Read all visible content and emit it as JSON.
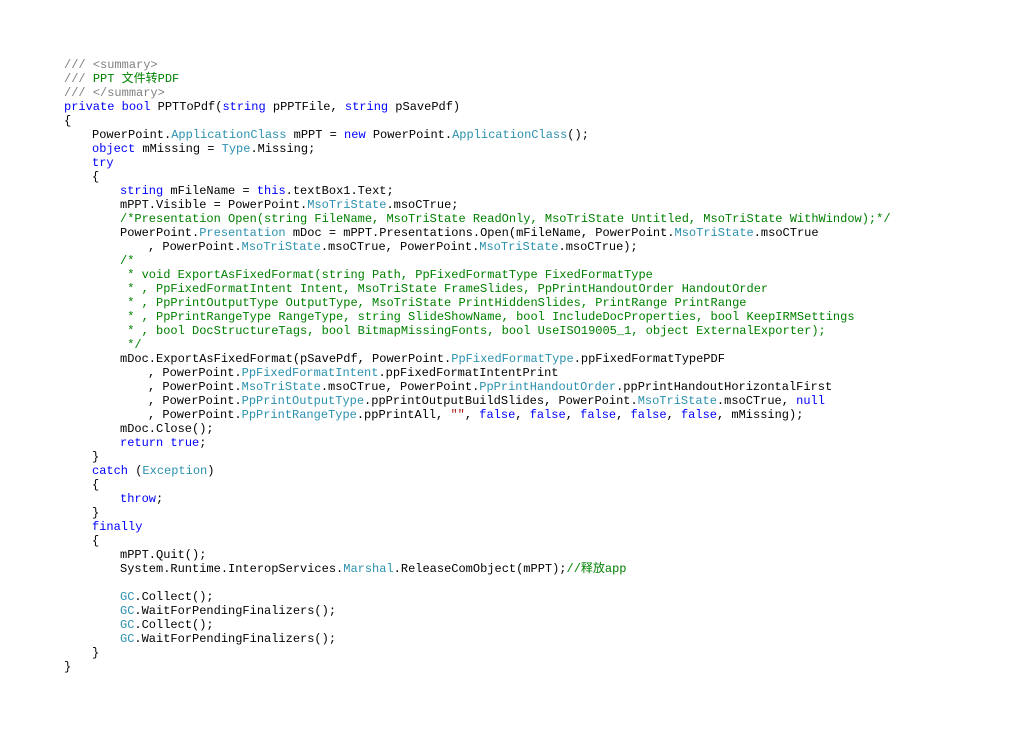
{
  "code": {
    "lines": [
      {
        "indent": 56,
        "tokens": [
          {
            "t": "/// ",
            "c": "c-comment"
          },
          {
            "t": "<summary>",
            "c": "c-comment"
          }
        ]
      },
      {
        "indent": 56,
        "tokens": [
          {
            "t": "/// ",
            "c": "c-comment"
          },
          {
            "t": "PPT 文件转PDF",
            "c": "c-doc"
          }
        ]
      },
      {
        "indent": 56,
        "tokens": [
          {
            "t": "/// ",
            "c": "c-comment"
          },
          {
            "t": "</summary>",
            "c": "c-comment"
          }
        ]
      },
      {
        "indent": 56,
        "tokens": [
          {
            "t": "private",
            "c": "c-kw"
          },
          {
            "t": " ",
            "c": "c-txt"
          },
          {
            "t": "bool",
            "c": "c-kw"
          },
          {
            "t": " PPTToPdf(",
            "c": "c-txt"
          },
          {
            "t": "string",
            "c": "c-kw"
          },
          {
            "t": " pPPTFile, ",
            "c": "c-txt"
          },
          {
            "t": "string",
            "c": "c-kw"
          },
          {
            "t": " pSavePdf)",
            "c": "c-txt"
          }
        ]
      },
      {
        "indent": 56,
        "tokens": [
          {
            "t": "{",
            "c": "c-txt"
          }
        ]
      },
      {
        "indent": 84,
        "tokens": [
          {
            "t": "PowerPoint.",
            "c": "c-txt"
          },
          {
            "t": "ApplicationClass",
            "c": "c-type"
          },
          {
            "t": " mPPT = ",
            "c": "c-txt"
          },
          {
            "t": "new",
            "c": "c-kw"
          },
          {
            "t": " PowerPoint.",
            "c": "c-txt"
          },
          {
            "t": "ApplicationClass",
            "c": "c-type"
          },
          {
            "t": "();",
            "c": "c-txt"
          }
        ]
      },
      {
        "indent": 84,
        "tokens": [
          {
            "t": "object",
            "c": "c-kw"
          },
          {
            "t": " mMissing = ",
            "c": "c-txt"
          },
          {
            "t": "Type",
            "c": "c-type"
          },
          {
            "t": ".Missing;",
            "c": "c-txt"
          }
        ]
      },
      {
        "indent": 84,
        "tokens": [
          {
            "t": "try",
            "c": "c-kw"
          }
        ]
      },
      {
        "indent": 84,
        "tokens": [
          {
            "t": "{",
            "c": "c-txt"
          }
        ]
      },
      {
        "indent": 112,
        "tokens": [
          {
            "t": "string",
            "c": "c-kw"
          },
          {
            "t": " mFileName = ",
            "c": "c-txt"
          },
          {
            "t": "this",
            "c": "c-kw"
          },
          {
            "t": ".textBox1.Text;",
            "c": "c-txt"
          }
        ]
      },
      {
        "indent": 112,
        "tokens": [
          {
            "t": "mPPT.Visible = PowerPoint.",
            "c": "c-txt"
          },
          {
            "t": "MsoTriState",
            "c": "c-type"
          },
          {
            "t": ".msoCTrue;",
            "c": "c-txt"
          }
        ]
      },
      {
        "indent": 112,
        "tokens": [
          {
            "t": "/*Presentation Open(string FileName, MsoTriState ReadOnly, MsoTriState Untitled, MsoTriState WithWindow);*/",
            "c": "c-doc"
          }
        ]
      },
      {
        "indent": 112,
        "tokens": [
          {
            "t": "PowerPoint.",
            "c": "c-txt"
          },
          {
            "t": "Presentation",
            "c": "c-type"
          },
          {
            "t": " mDoc = mPPT.Presentations.Open(mFileName, PowerPoint.",
            "c": "c-txt"
          },
          {
            "t": "MsoTriState",
            "c": "c-type"
          },
          {
            "t": ".msoCTrue",
            "c": "c-txt"
          }
        ]
      },
      {
        "indent": 140,
        "tokens": [
          {
            "t": ", PowerPoint.",
            "c": "c-txt"
          },
          {
            "t": "MsoTriState",
            "c": "c-type"
          },
          {
            "t": ".msoCTrue, PowerPoint.",
            "c": "c-txt"
          },
          {
            "t": "MsoTriState",
            "c": "c-type"
          },
          {
            "t": ".msoCTrue);",
            "c": "c-txt"
          }
        ]
      },
      {
        "indent": 112,
        "tokens": [
          {
            "t": "/*",
            "c": "c-doc"
          }
        ]
      },
      {
        "indent": 112,
        "tokens": [
          {
            "t": " * void ExportAsFixedFormat(string Path, PpFixedFormatType FixedFormatType",
            "c": "c-doc"
          }
        ]
      },
      {
        "indent": 112,
        "tokens": [
          {
            "t": " * , PpFixedFormatIntent Intent, MsoTriState FrameSlides, PpPrintHandoutOrder HandoutOrder",
            "c": "c-doc"
          }
        ]
      },
      {
        "indent": 112,
        "tokens": [
          {
            "t": " * , PpPrintOutputType OutputType, MsoTriState PrintHiddenSlides, PrintRange PrintRange",
            "c": "c-doc"
          }
        ]
      },
      {
        "indent": 112,
        "tokens": [
          {
            "t": " * , PpPrintRangeType RangeType, string SlideShowName, bool IncludeDocProperties, bool KeepIRMSettings",
            "c": "c-doc"
          }
        ]
      },
      {
        "indent": 112,
        "tokens": [
          {
            "t": " * , bool DocStructureTags, bool BitmapMissingFonts, bool UseISO19005_1, object ExternalExporter);",
            "c": "c-doc"
          }
        ]
      },
      {
        "indent": 112,
        "tokens": [
          {
            "t": " */",
            "c": "c-doc"
          }
        ]
      },
      {
        "indent": 112,
        "tokens": [
          {
            "t": "mDoc.ExportAsFixedFormat(pSavePdf, PowerPoint.",
            "c": "c-txt"
          },
          {
            "t": "PpFixedFormatType",
            "c": "c-type"
          },
          {
            "t": ".ppFixedFormatTypePDF",
            "c": "c-txt"
          }
        ]
      },
      {
        "indent": 140,
        "tokens": [
          {
            "t": ", PowerPoint.",
            "c": "c-txt"
          },
          {
            "t": "PpFixedFormatIntent",
            "c": "c-type"
          },
          {
            "t": ".ppFixedFormatIntentPrint",
            "c": "c-txt"
          }
        ]
      },
      {
        "indent": 140,
        "tokens": [
          {
            "t": ", PowerPoint.",
            "c": "c-txt"
          },
          {
            "t": "MsoTriState",
            "c": "c-type"
          },
          {
            "t": ".msoCTrue, PowerPoint.",
            "c": "c-txt"
          },
          {
            "t": "PpPrintHandoutOrder",
            "c": "c-type"
          },
          {
            "t": ".ppPrintHandoutHorizontalFirst",
            "c": "c-txt"
          }
        ]
      },
      {
        "indent": 140,
        "tokens": [
          {
            "t": ", PowerPoint.",
            "c": "c-txt"
          },
          {
            "t": "PpPrintOutputType",
            "c": "c-type"
          },
          {
            "t": ".ppPrintOutputBuildSlides, PowerPoint.",
            "c": "c-txt"
          },
          {
            "t": "MsoTriState",
            "c": "c-type"
          },
          {
            "t": ".msoCTrue, ",
            "c": "c-txt"
          },
          {
            "t": "null",
            "c": "c-kw"
          }
        ]
      },
      {
        "indent": 140,
        "tokens": [
          {
            "t": ", PowerPoint.",
            "c": "c-txt"
          },
          {
            "t": "PpPrintRangeType",
            "c": "c-type"
          },
          {
            "t": ".ppPrintAll, ",
            "c": "c-txt"
          },
          {
            "t": "\"\"",
            "c": "c-str"
          },
          {
            "t": ", ",
            "c": "c-txt"
          },
          {
            "t": "false",
            "c": "c-kw"
          },
          {
            "t": ", ",
            "c": "c-txt"
          },
          {
            "t": "false",
            "c": "c-kw"
          },
          {
            "t": ", ",
            "c": "c-txt"
          },
          {
            "t": "false",
            "c": "c-kw"
          },
          {
            "t": ", ",
            "c": "c-txt"
          },
          {
            "t": "false",
            "c": "c-kw"
          },
          {
            "t": ", ",
            "c": "c-txt"
          },
          {
            "t": "false",
            "c": "c-kw"
          },
          {
            "t": ", mMissing);",
            "c": "c-txt"
          }
        ]
      },
      {
        "indent": 112,
        "tokens": [
          {
            "t": "mDoc.Close();",
            "c": "c-txt"
          }
        ]
      },
      {
        "indent": 112,
        "tokens": [
          {
            "t": "return",
            "c": "c-kw"
          },
          {
            "t": " ",
            "c": "c-txt"
          },
          {
            "t": "true",
            "c": "c-kw"
          },
          {
            "t": ";",
            "c": "c-txt"
          }
        ]
      },
      {
        "indent": 84,
        "tokens": [
          {
            "t": "}",
            "c": "c-txt"
          }
        ]
      },
      {
        "indent": 84,
        "tokens": [
          {
            "t": "catch",
            "c": "c-kw"
          },
          {
            "t": " (",
            "c": "c-txt"
          },
          {
            "t": "Exception",
            "c": "c-type"
          },
          {
            "t": ")",
            "c": "c-txt"
          }
        ]
      },
      {
        "indent": 84,
        "tokens": [
          {
            "t": "{",
            "c": "c-txt"
          }
        ]
      },
      {
        "indent": 112,
        "tokens": [
          {
            "t": "throw",
            "c": "c-kw"
          },
          {
            "t": ";",
            "c": "c-txt"
          }
        ]
      },
      {
        "indent": 84,
        "tokens": [
          {
            "t": "}",
            "c": "c-txt"
          }
        ]
      },
      {
        "indent": 84,
        "tokens": [
          {
            "t": "finally",
            "c": "c-kw"
          }
        ]
      },
      {
        "indent": 84,
        "tokens": [
          {
            "t": "{",
            "c": "c-txt"
          }
        ]
      },
      {
        "indent": 112,
        "tokens": [
          {
            "t": "mPPT.Quit();",
            "c": "c-txt"
          }
        ]
      },
      {
        "indent": 112,
        "tokens": [
          {
            "t": "System.Runtime.InteropServices.",
            "c": "c-txt"
          },
          {
            "t": "Marshal",
            "c": "c-type"
          },
          {
            "t": ".ReleaseComObject(mPPT);",
            "c": "c-txt"
          },
          {
            "t": "//释放app",
            "c": "c-doc"
          }
        ]
      },
      {
        "indent": 112,
        "tokens": []
      },
      {
        "indent": 112,
        "tokens": [
          {
            "t": "GC",
            "c": "c-type"
          },
          {
            "t": ".Collect();",
            "c": "c-txt"
          }
        ]
      },
      {
        "indent": 112,
        "tokens": [
          {
            "t": "GC",
            "c": "c-type"
          },
          {
            "t": ".WaitForPendingFinalizers();",
            "c": "c-txt"
          }
        ]
      },
      {
        "indent": 112,
        "tokens": [
          {
            "t": "GC",
            "c": "c-type"
          },
          {
            "t": ".Collect();",
            "c": "c-txt"
          }
        ]
      },
      {
        "indent": 112,
        "tokens": [
          {
            "t": "GC",
            "c": "c-type"
          },
          {
            "t": ".WaitForPendingFinalizers();",
            "c": "c-txt"
          }
        ]
      },
      {
        "indent": 84,
        "tokens": [
          {
            "t": "}",
            "c": "c-txt"
          }
        ]
      },
      {
        "indent": 56,
        "tokens": [
          {
            "t": "}",
            "c": "c-txt"
          }
        ]
      }
    ]
  }
}
